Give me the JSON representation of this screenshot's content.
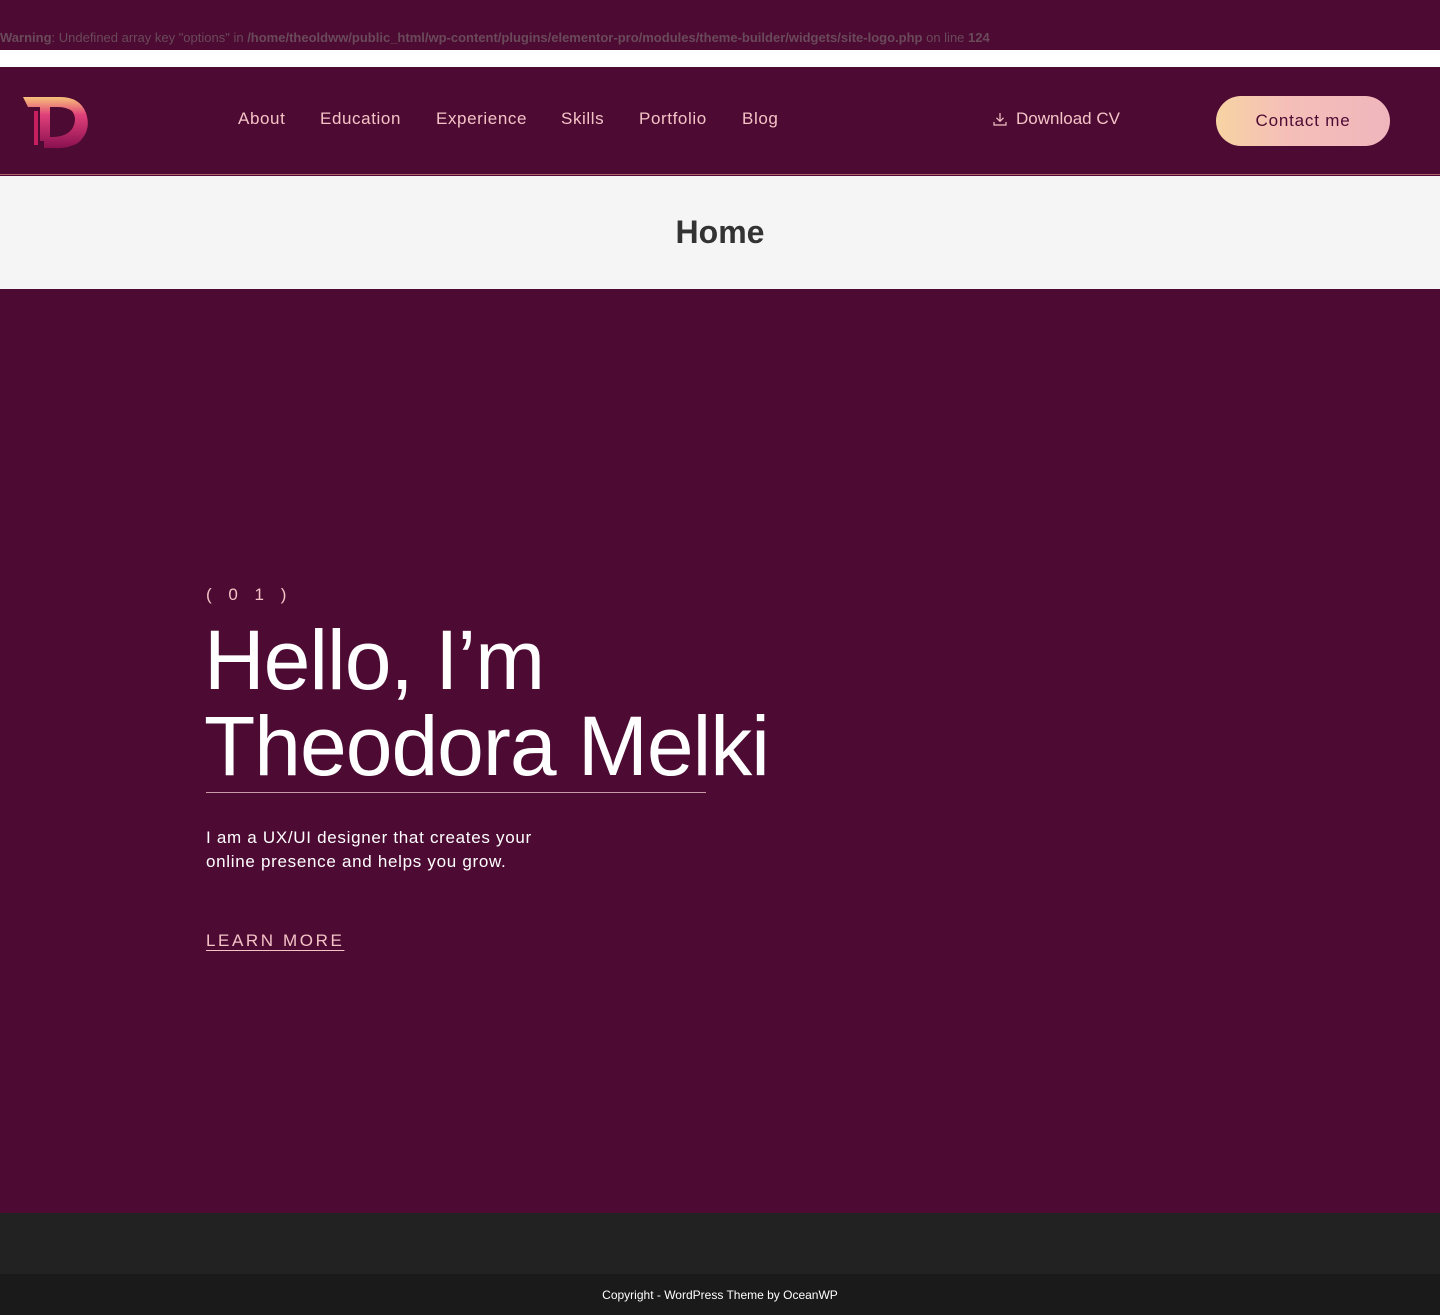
{
  "warning": {
    "label": "Warning",
    "message_before": ": Undefined array key \"options\" in ",
    "file_path": "/home/theoldww/public_html/wp-content/plugins/elementor-pro/modules/theme-builder/widgets/site-logo.php",
    "message_after": " on line ",
    "line_number": "124"
  },
  "header": {
    "logo_text": "TD",
    "nav": [
      "About",
      "Education",
      "Experience",
      "Skills",
      "Portfolio",
      "Blog"
    ],
    "download_label": "Download CV",
    "contact_label": "Contact me"
  },
  "page_title": "Home",
  "hero": {
    "number": "( 0 1 )",
    "heading_line1": "Hello, I’m",
    "heading_line2": "Theodora Melki",
    "description_line1": "I am a UX/UI designer that creates your",
    "description_line2": "online presence and helps you grow.",
    "cta": "LEARN MORE"
  },
  "footer": {
    "copyright": "Copyright - WordPress Theme by OceanWP"
  },
  "colors": {
    "brand_background": "#4d0a33",
    "accent_pink": "#f4c3c6",
    "button_gradient_start": "#f7d3a2",
    "button_gradient_end": "#f0b6bd"
  }
}
